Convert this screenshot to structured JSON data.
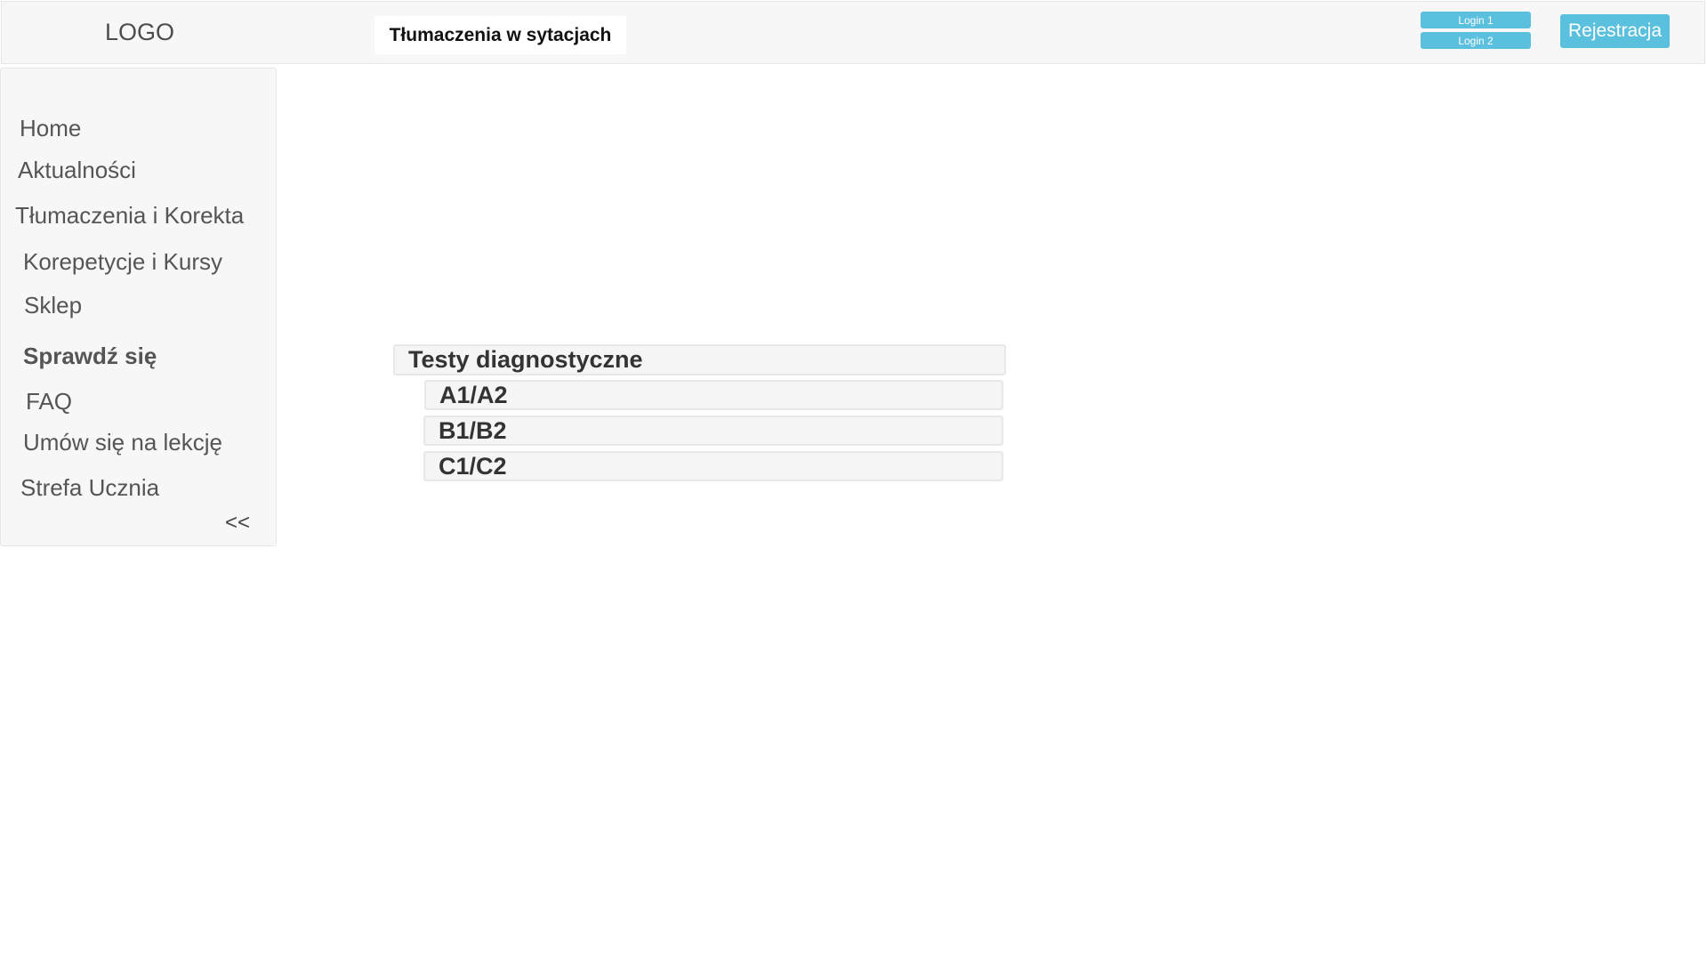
{
  "header": {
    "logo": "LOGO",
    "active_tab": "Tłumaczenia w sytacjach",
    "login1": "Login 1",
    "login2": "Login 2",
    "register": "Rejestracja"
  },
  "sidebar": {
    "items": [
      "Home",
      "Aktualności",
      "Tłumaczenia i Korekta",
      "Korepetycje i Kursy",
      "Sklep",
      "Sprawdź się",
      "FAQ",
      "Umów się na lekcję",
      "Strefa Ucznia"
    ],
    "collapse": "<<"
  },
  "tests": {
    "title": "Testy diagnostyczne",
    "levels": [
      "A1/A2",
      "B1/B2",
      "C1/C2"
    ]
  },
  "colors": {
    "accent": "#5bc0de",
    "panel": "#f7f7f7"
  }
}
